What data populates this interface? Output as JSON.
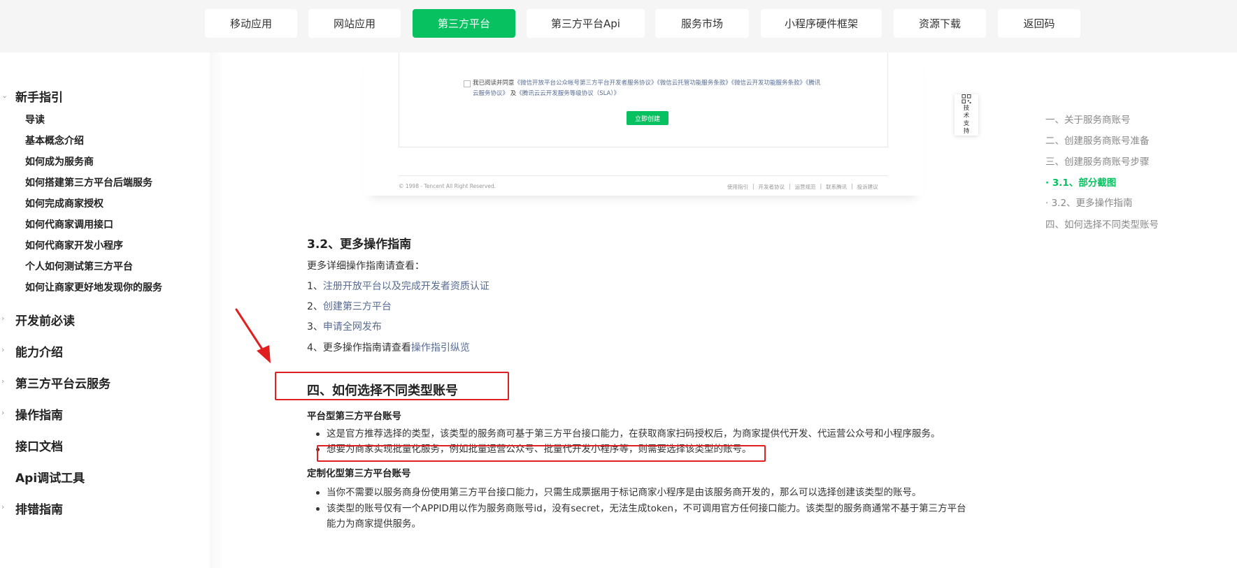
{
  "nav": {
    "tabs": [
      {
        "label": "移动应用"
      },
      {
        "label": "网站应用"
      },
      {
        "label": "第三方平台"
      },
      {
        "label": "第三方平台Api"
      },
      {
        "label": "服务市场"
      },
      {
        "label": "小程序硬件框架"
      },
      {
        "label": "资源下载"
      },
      {
        "label": "返回码"
      }
    ],
    "active_index": 2,
    "accent_color": "#07c160"
  },
  "sidebar": {
    "guide_title": "新手指引",
    "guide_items": [
      "导读",
      "基本概念介绍",
      "如何成为服务商",
      "如何搭建第三方平台后端服务",
      "如何完成商家授权",
      "如何代商家调用接口",
      "如何代商家开发小程序",
      "个人如何测试第三方平台",
      "如何让商家更好地发现你的服务"
    ],
    "groups": [
      "开发前必读",
      "能力介绍",
      "第三方平台云服务",
      "操作指南",
      "接口文档",
      "Api调试工具",
      "排错指南"
    ]
  },
  "screenshot": {
    "agree_prefix": "我已阅读并同意",
    "agree_link1": "《微信开放平台公众帐号第三方平台开发者服务协议》",
    "agree_link2": "《微信云托管功能服务条款》",
    "agree_link3": "《微信云开发功能服务条款》",
    "agree_link4": "《腾讯云服务协议》",
    "agree_and": "及",
    "agree_link5": "《腾讯云云开发服务等级协议（SLA）》",
    "create_button": "立即创建",
    "copyright": "© 1998 - Tencent All Right Reserved.",
    "footer_links": [
      "使用指引",
      "|",
      "开发者协议",
      "|",
      "运营规范",
      "|",
      "联系腾讯",
      "|",
      "投诉建议"
    ]
  },
  "support_widget": {
    "label": "技术支持",
    "icon": "qrcode-icon"
  },
  "content": {
    "section_32_title": "3.2、更多操作指南",
    "section_32_intro": "更多详细操作指南请查看：",
    "section_32_items": [
      {
        "prefix": "1、",
        "link": "注册开放平台以及完成开发者资质认证"
      },
      {
        "prefix": "2、",
        "link": "创建第三方平台"
      },
      {
        "prefix": "3、",
        "link": "申请全网发布"
      },
      {
        "prefix": "4、更多操作指南请查看",
        "link": "操作指引纵览"
      }
    ],
    "section_4_title": "四、如何选择不同类型账号",
    "platform_title": "平台型第三方平台账号",
    "platform_bullets": [
      "这是官方推荐选择的类型，该类型的服务商可基于第三方平台接口能力，在获取商家扫码授权后，为商家提供代开发、代运营公众号和小程序服务。",
      "想要为商家实现批量化服务，例如批量运营公众号、批量代开发小程序等，则需要选择该类型的账号。"
    ],
    "custom_title": "定制化型第三方平台账号",
    "custom_bullets": [
      "当你不需要以服务商身份使用第三方平台接口能力，只需生成票据用于标记商家小程序是由该服务商开发的，那么可以选择创建该类型的账号。",
      "该类型的账号仅有一个APPID用以作为服务商账号id，没有secret，无法生成token，不可调用官方任何接口能力。该类型的服务商通常不基于第三方平台能力为商家提供服务。"
    ]
  },
  "toc": {
    "items": [
      "一、关于服务商账号",
      "二、创建服务商账号准备",
      "三、创建服务商账号步骤",
      "· 3.1、部分截图",
      "· 3.2、更多操作指南",
      "四、如何选择不同类型账号"
    ],
    "active_index": 3
  },
  "annotation_color": "#e02020"
}
